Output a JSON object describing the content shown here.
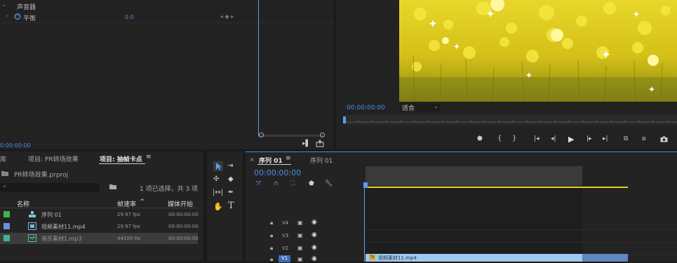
{
  "effect_controls": {
    "row1_label": "声音器",
    "row2_label": "平衡",
    "row2_value": "0.0",
    "timecode": "0:00:00:00"
  },
  "program": {
    "timecode": "00:00:00:00",
    "fit_label": "适合"
  },
  "project": {
    "tab_partial": "库",
    "tab_project1": "项目: PR转场效果",
    "tab_project2": "项目: 抽帧卡点",
    "file_name": "PR转场效果.prproj",
    "selection_info": "1 项已选择，共 3 项",
    "columns": {
      "name": "名称",
      "fps": "帧速率",
      "start": "媒体开始"
    },
    "items": [
      {
        "name": "序列 01",
        "fps": "29.97 fps",
        "start": "00:00:00:00",
        "color": "#3fb34f"
      },
      {
        "name": "视频素材11.mp4",
        "fps": "29.97 fps",
        "start": "00:00:00:00",
        "color": "#6d8fd6"
      },
      {
        "name": "音乐素材1.mp3",
        "fps": "44100 Hz",
        "start": "00:00:00:00",
        "color": "#3fb39a"
      }
    ]
  },
  "timeline": {
    "tab_active": "序列 01",
    "tab_other": "序列 01",
    "timecode": "00:00:00:00",
    "tracks": [
      "V4",
      "V3",
      "V2",
      "V1"
    ],
    "clip_label": "视频素材11.mp4"
  },
  "colors": {
    "accent": "#4a90e2",
    "playhead": "#5b9cf0"
  }
}
